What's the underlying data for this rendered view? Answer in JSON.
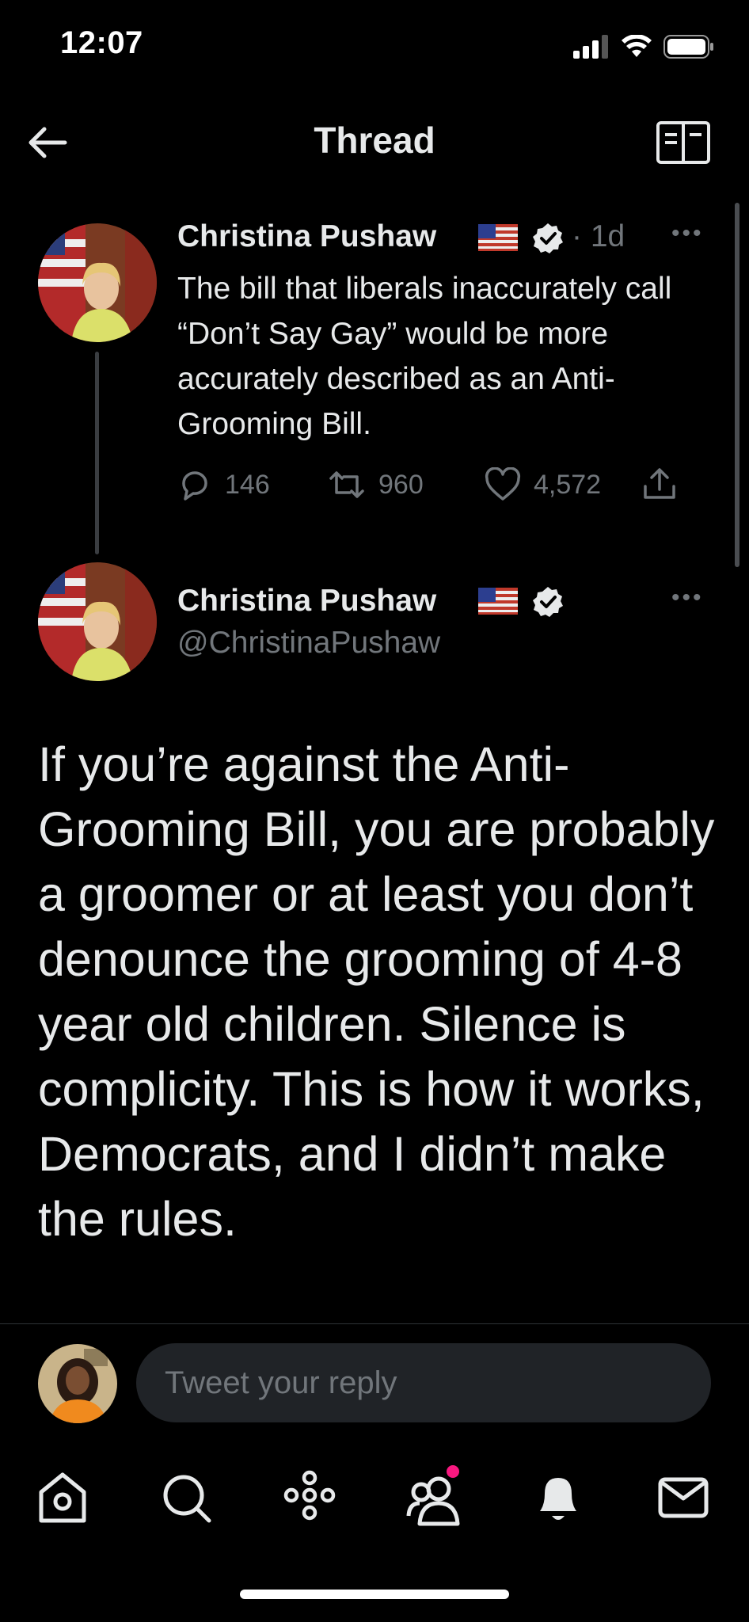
{
  "status_bar": {
    "time": "12:07"
  },
  "nav": {
    "title": "Thread"
  },
  "parent_tweet": {
    "author_name": "Christina Pushaw",
    "time": "· 1d",
    "text": "The bill that liberals inaccurately call “Don’t Say Gay” would be more accurately described as an Anti-Grooming Bill.",
    "replies": "146",
    "retweets": "960",
    "likes": "4,572"
  },
  "main_tweet": {
    "author_name": "Christina Pushaw",
    "handle": "@ChristinaPushaw",
    "text": "If you’re against the Anti-Grooming Bill, you are probably a groomer or at least you don’t denounce the grooming of 4-8 year old children. Silence is complicity. This is how it works, Democrats, and I didn’t make the rules."
  },
  "reply": {
    "placeholder": "Tweet your reply"
  },
  "tabbar": {
    "items": [
      "home-icon",
      "search-icon",
      "spaces-icon",
      "communities-icon",
      "notifications-icon",
      "messages-icon"
    ]
  },
  "colors": {
    "background": "#000000",
    "text": "#e7e9ea",
    "muted": "#71767b",
    "notification_dot": "#f91880"
  }
}
